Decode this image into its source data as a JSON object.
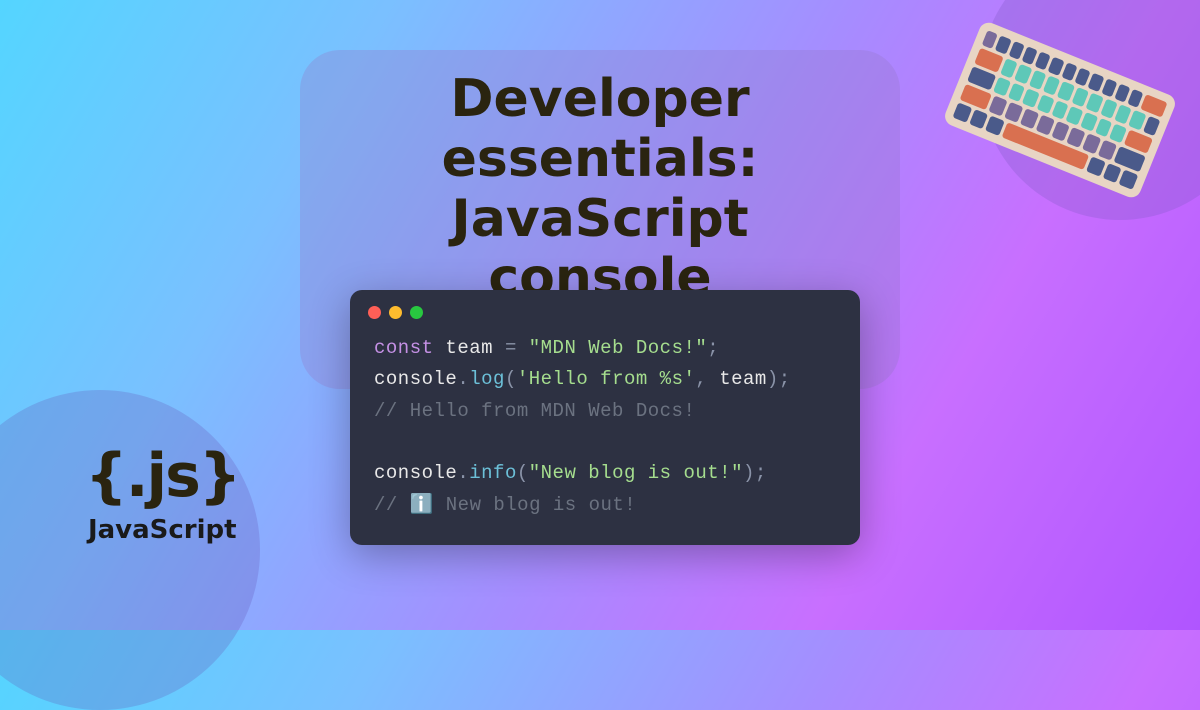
{
  "title": "Developer essentials:\nJavaScript console\nmethods",
  "badge": {
    "logo": "{.js}",
    "label": "JavaScript"
  },
  "code": {
    "line1_kw": "const",
    "line1_var": " team ",
    "line1_eq": "= ",
    "line1_str": "\"MDN Web Docs!\"",
    "line1_end": ";",
    "line2_obj": "console",
    "line2_dot": ".",
    "line2_method": "log",
    "line2_open": "(",
    "line2_str": "'Hello from %s'",
    "line2_comma": ", ",
    "line2_arg": "team",
    "line2_close": ");",
    "line3_comment": "// Hello from MDN Web Docs!",
    "line5_obj": "console",
    "line5_dot": ".",
    "line5_method": "info",
    "line5_open": "(",
    "line5_str": "\"New blog is out!\"",
    "line5_close": ");",
    "line6_comment": "// ℹ️ New blog is out!"
  }
}
